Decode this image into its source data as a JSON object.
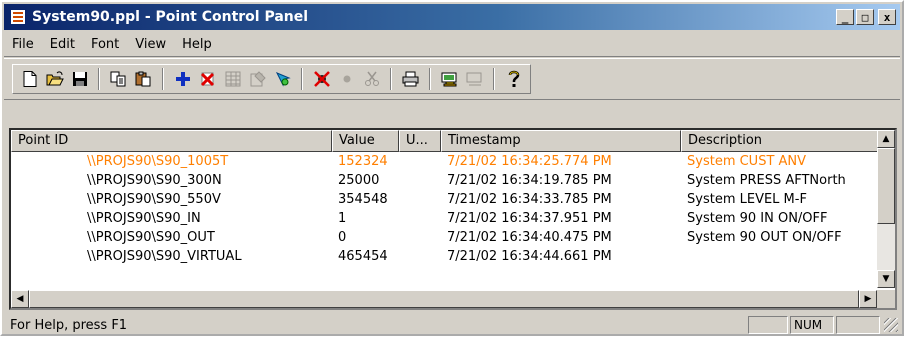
{
  "window": {
    "title": "System90.ppl - Point Control Panel",
    "minimize": "_",
    "maximize": "□",
    "close": "x"
  },
  "menu": [
    "File",
    "Edit",
    "Font",
    "View",
    "Help"
  ],
  "toolbar": {
    "icons": [
      "new-icon",
      "open-icon",
      "save-icon",
      "copy-icon",
      "paste-icon",
      "add-point-icon",
      "delete-point-icon",
      "grid-icon",
      "properties-icon",
      "refresh-icon",
      "alarm-icon",
      "dot-icon",
      "cut-disabled-icon",
      "print-icon",
      "lock-icon",
      "monitor-disabled-icon",
      "help-icon"
    ]
  },
  "list": {
    "columns": [
      "Point ID",
      "Value",
      "U...",
      "Timestamp",
      "Description"
    ],
    "rows": [
      {
        "id": "\\\\PROJS90\\S90_1005T",
        "value": "152324",
        "unit": "",
        "timestamp": "7/21/02  16:34:25.774 PM",
        "description": "System CUST ANV"
      },
      {
        "id": "\\\\PROJS90\\S90_300N",
        "value": "25000",
        "unit": "",
        "timestamp": "7/21/02  16:34:19.785 PM",
        "description": "System PRESS AFTNorth"
      },
      {
        "id": "\\\\PROJS90\\S90_550V",
        "value": "354548",
        "unit": "",
        "timestamp": "7/21/02  16:34:33.785 PM",
        "description": "System LEVEL M-F"
      },
      {
        "id": "\\\\PROJS90\\S90_IN",
        "value": "1",
        "unit": "",
        "timestamp": "7/21/02  16:34:37.951 PM",
        "description": "System 90 IN ON/OFF"
      },
      {
        "id": "\\\\PROJS90\\S90_OUT",
        "value": "0",
        "unit": "",
        "timestamp": "7/21/02  16:34:40.475 PM",
        "description": "System 90 OUT ON/OFF"
      },
      {
        "id": "\\\\PROJS90\\S90_VIRTUAL",
        "value": "465454",
        "unit": "",
        "timestamp": "7/21/02  16:34:44.661 PM",
        "description": ""
      }
    ],
    "highlight_color": "#ff7f00"
  },
  "status": {
    "text": "For Help, press F1",
    "pane1": "",
    "num": "NUM",
    "pane3": ""
  }
}
